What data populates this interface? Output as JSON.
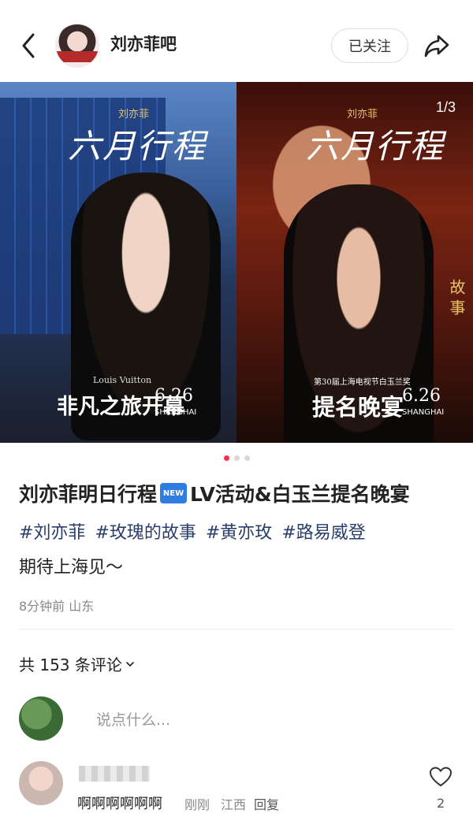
{
  "header": {
    "title": "刘亦菲吧",
    "follow_label": "已关注"
  },
  "hero": {
    "counter": "1/3",
    "left": {
      "script_title": "六月行程",
      "small_name": "刘亦菲",
      "brand": "Louis Vuitton",
      "event": "非凡之旅开幕",
      "date": "6.26",
      "city": "SHANGHAI"
    },
    "right": {
      "script_title": "六月行程",
      "small_name": "刘亦菲",
      "subtitle": "第30届上海电视节白玉兰奖",
      "event": "提名晚宴",
      "date": "6.26",
      "city": "SHANGHAI",
      "vertical": "故事"
    }
  },
  "carousel": {
    "count": 3,
    "active": 0
  },
  "post": {
    "title_part1": "刘亦菲明日行程",
    "new_badge": "NEW",
    "title_part2": "LV活动&白玉兰提名晚宴",
    "tags": [
      "#刘亦菲",
      "#玫瑰的故事",
      "#黄亦玫",
      "#路易威登"
    ],
    "body": "期待上海见～",
    "meta": "8分钟前 山东"
  },
  "comments": {
    "count_label": "共 153 条评论",
    "input_placeholder": "说点什么...",
    "items": [
      {
        "text": "啊啊啊啊啊啊",
        "time": "刚刚",
        "location": "江西",
        "reply_label": "回复",
        "likes": "2"
      }
    ]
  },
  "icons": {
    "back": "chevron-left-icon",
    "share": "share-icon",
    "chevron": "chevron-down-icon",
    "like": "heart-icon"
  },
  "colors": {
    "accent": "#ff2e4d",
    "tag": "#2a3e6b",
    "new_badge": "#2f7de0"
  }
}
